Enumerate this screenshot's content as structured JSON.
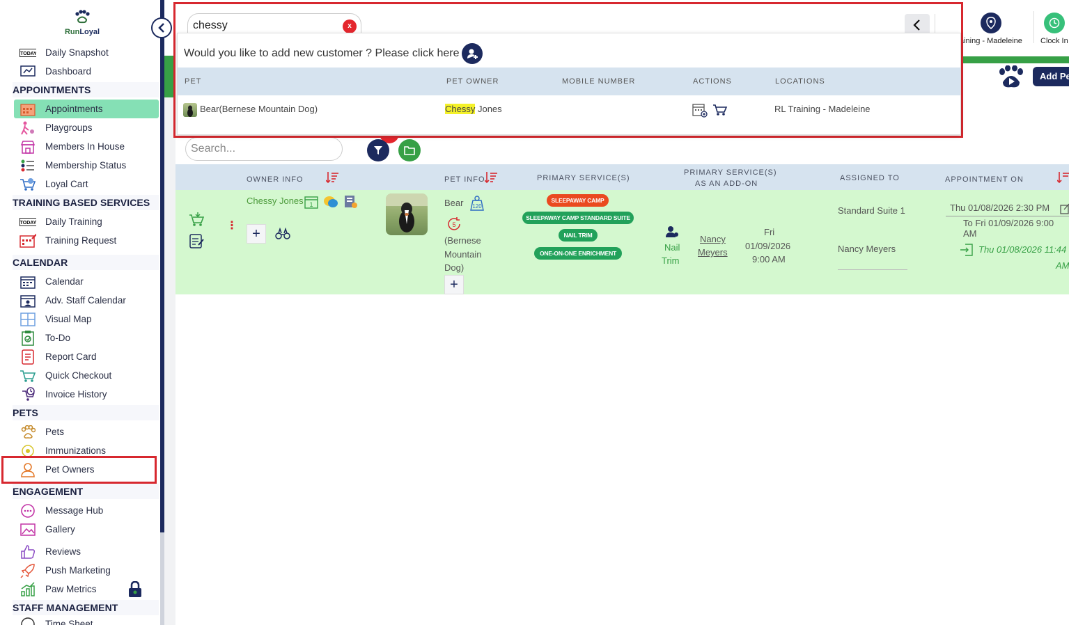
{
  "brand": {
    "logo_text_run": "Run",
    "logo_text_loyal": "Loyal"
  },
  "sidebar": {
    "items": [
      {
        "label": "Daily Snapshot"
      },
      {
        "label": "Dashboard"
      },
      {
        "label": "Appointments"
      },
      {
        "label": "Playgroups"
      },
      {
        "label": "Members In House"
      },
      {
        "label": "Membership Status"
      },
      {
        "label": "Loyal Cart"
      },
      {
        "label": "Daily Training"
      },
      {
        "label": "Training Request"
      },
      {
        "label": "Calendar"
      },
      {
        "label": "Adv. Staff Calendar"
      },
      {
        "label": "Visual Map"
      },
      {
        "label": "To-Do"
      },
      {
        "label": "Report Card"
      },
      {
        "label": "Quick Checkout"
      },
      {
        "label": "Invoice History"
      },
      {
        "label": "Pets"
      },
      {
        "label": "Immunizations"
      },
      {
        "label": "Pet Owners"
      },
      {
        "label": "Message Hub"
      },
      {
        "label": "Gallery"
      },
      {
        "label": "Reviews"
      },
      {
        "label": "Push Marketing"
      },
      {
        "label": "Paw Metrics"
      },
      {
        "label": "Time Sheet"
      }
    ],
    "sections": [
      "APPOINTMENTS",
      "TRAINING BASED SERVICES",
      "CALENDAR",
      "PETS",
      "ENGAGEMENT",
      "STAFF MANAGEMENT"
    ]
  },
  "topbar": {
    "location_label": "aining - Madeleine",
    "clock_in_label": "Clock In",
    "add_pet_label": "Add Pet"
  },
  "search_popup": {
    "query": "chessy",
    "clear_symbol": "x",
    "add_customer_prompt": "Would you like to add new customer ? Please click here",
    "columns": [
      "PET",
      "PET OWNER",
      "MOBILE NUMBER",
      "ACTIONS",
      "LOCATIONS"
    ],
    "result": {
      "pet": "Bear(Bernese Mountain Dog)",
      "owner_highlight": "Chessy",
      "owner_rest": " Jones",
      "mobile": "",
      "location": "RL Training - Madeleine"
    }
  },
  "list_search": {
    "placeholder": "Search..."
  },
  "table": {
    "headers": {
      "owner": "OWNER INFO",
      "pet": "PET INFO",
      "primary": "PRIMARY SERVICE(S)",
      "addon_line1": "PRIMARY SERVICE(S)",
      "addon_line2": "AS AN ADD-ON",
      "assigned": "ASSIGNED TO",
      "appt": "APPOINTMENT ON"
    },
    "row": {
      "owner_name": "Chessy Jones",
      "calendar_badge": "1",
      "pet_name": "Bear",
      "pet_weight": "120",
      "pet_visits": "5",
      "pet_breed_l1": "(Bernese",
      "pet_breed_l2": "Mountain",
      "pet_breed_l3": "Dog)",
      "services": [
        "SLEEPAWAY CAMP",
        "SLEEPAWAY CAMP STANDARD SUITE",
        "NAIL TRIM",
        "ONE-ON-ONE ENRICHMENT"
      ],
      "addon_name_l1": "Nail",
      "addon_name_l2": "Trim",
      "addon_staff_l1": "Nancy",
      "addon_staff_l2": "Meyers",
      "addon_day": "Fri",
      "addon_date": "01/09/2026",
      "addon_time": "9:00 AM",
      "assigned_suite": "Standard Suite 1",
      "assigned_staff": "Nancy Meyers",
      "appt_from": "Thu 01/08/2026 2:30 PM",
      "appt_to": "To Fri 01/09/2026 9:00 AM",
      "checkin_l1": "Thu 01/08/2026 11:44",
      "checkin_l2": "AM"
    }
  },
  "colors": {
    "navy": "#1c2a5e",
    "green": "#37a046",
    "active_green": "#85e0b5",
    "row_green": "#d4f8cf",
    "header_blue": "#d6e3ef",
    "highlight_red": "#d7282f",
    "pill_red": "#ea4a1f",
    "pill_green": "#22a15a"
  }
}
